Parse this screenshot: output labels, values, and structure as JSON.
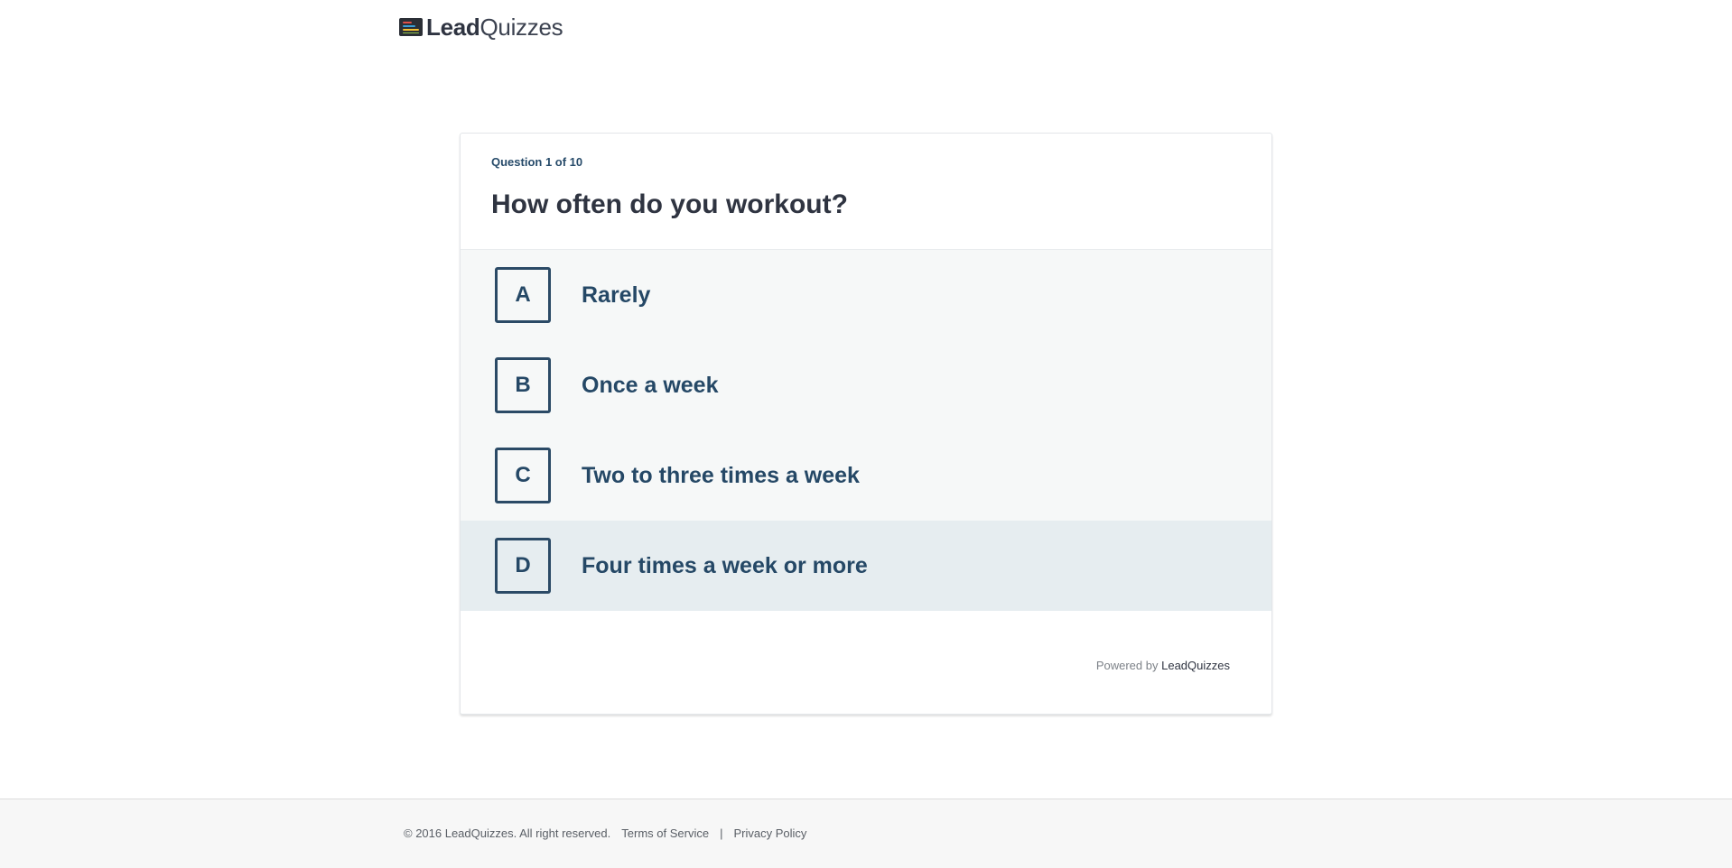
{
  "header": {
    "logo_icon": "leadquizzes-logo-icon",
    "logo_bold": "Lead",
    "logo_light": "Quizzes"
  },
  "quiz": {
    "question_count": "Question 1 of 10",
    "question": "How often do you workout?",
    "answers": [
      {
        "letter": "A",
        "text": "Rarely"
      },
      {
        "letter": "B",
        "text": "Once a week"
      },
      {
        "letter": "C",
        "text": "Two to three times a week"
      },
      {
        "letter": "D",
        "text": "Four times a week or more"
      }
    ],
    "hovered_answer": "D",
    "powered_by_label": "Powered by",
    "powered_by_brand": "LeadQuizzes"
  },
  "footer": {
    "copyright": "© 2016 LeadQuizzes. All right reserved.",
    "terms": "Terms of Service",
    "separator": "|",
    "privacy": "Privacy Policy"
  },
  "colors": {
    "accent": "#254866",
    "answers_bg": "#f6f8f8",
    "hover_bg": "#e6edf0",
    "footer_bg": "#f7f7f7"
  }
}
